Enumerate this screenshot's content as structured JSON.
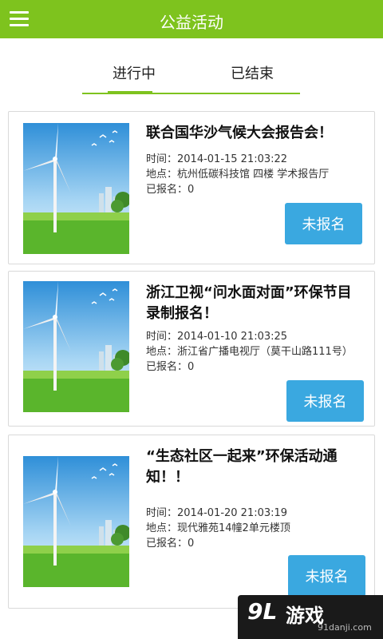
{
  "header": {
    "title": "公益活动",
    "menu_icon": "hamburger-menu-icon",
    "bg_color": "#7ec31e"
  },
  "tabs": [
    {
      "label": "进行中",
      "active": true
    },
    {
      "label": "已结束",
      "active": false
    }
  ],
  "events": [
    {
      "title": "联合国华沙气候大会报告会！",
      "time": "时间：2014-01-15 21:03:22",
      "location": "地点：杭州低碳科技馆 四楼 学术报告厅",
      "registered": "已报名：0",
      "button": "未报名",
      "image": "wind-turbine-image"
    },
    {
      "title": "浙江卫视“问水面对面”环保节目录制报名！",
      "time": "时间：2014-01-10 21:03:25",
      "location": "地点：浙江省广播电视厅（莫干山路111号）",
      "registered": "已报名：0",
      "button": "未报名",
      "image": "wind-turbine-image"
    },
    {
      "title": "“生态社区一起来”环保活动通知！！",
      "time": "时间：2014-01-20 21:03:19",
      "location": "地点：现代雅苑14幢2单元楼顶",
      "registered": "已报名：0",
      "button": "未报名",
      "image": "wind-turbine-image"
    }
  ],
  "colors": {
    "accent": "#7ec31e",
    "button": "#3aa8e0"
  },
  "watermark": {
    "logo": "9L",
    "text": "游戏",
    "url": "91danji.com"
  }
}
